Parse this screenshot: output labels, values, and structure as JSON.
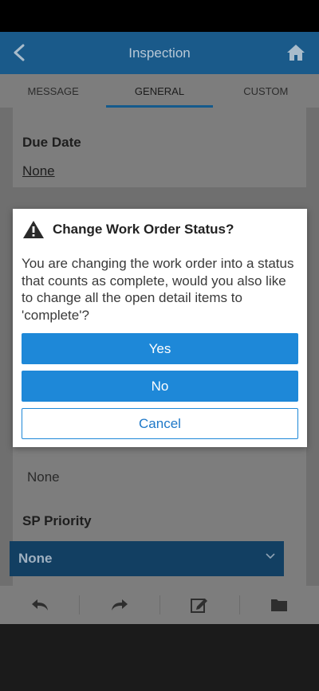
{
  "header": {
    "title": "Inspection"
  },
  "tabs": [
    {
      "label": "MESSAGE"
    },
    {
      "label": "GENERAL"
    },
    {
      "label": "CUSTOM"
    }
  ],
  "fields": {
    "due_date": {
      "label": "Due Date",
      "value": "None"
    },
    "priority_value": "None",
    "sp_priority": {
      "label": "SP Priority",
      "value": "None"
    }
  },
  "dialog": {
    "title": "Change Work Order Status?",
    "message": "You are changing the work order into a status that counts as complete, would you also like to change all the open detail items to 'complete'?",
    "yes_label": "Yes",
    "no_label": "No",
    "cancel_label": "Cancel"
  },
  "colors": {
    "app_bar": "#1a5a8a",
    "primary_button": "#1e88d8",
    "dialog_background": "#ffffff"
  },
  "icons": {
    "back": "back-arrow-icon",
    "home": "home-icon",
    "warning": "warning-icon",
    "reply": "reply-icon",
    "forward": "forward-icon",
    "edit": "edit-icon",
    "folder": "folder-icon",
    "chevron": "chevron-down-icon"
  }
}
